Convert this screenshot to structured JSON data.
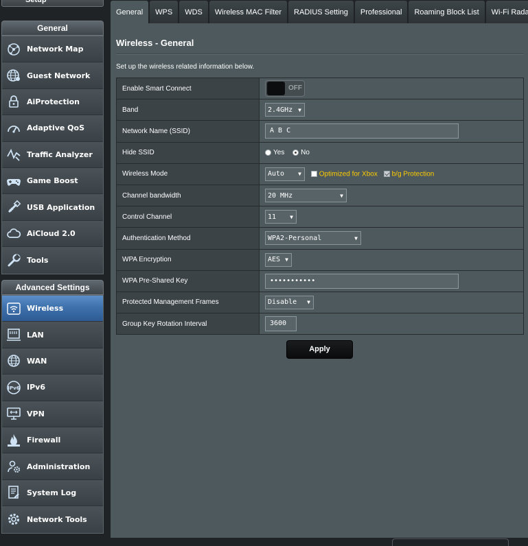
{
  "sidebar": {
    "setup_label": "Setup",
    "general_header": "General",
    "general_items": [
      {
        "label": "Network Map",
        "icon": "network-map-icon"
      },
      {
        "label": "Guest Network",
        "icon": "globe-icon"
      },
      {
        "label": "AiProtection",
        "icon": "lock-icon"
      },
      {
        "label": "Adaptive QoS",
        "icon": "gauge-icon"
      },
      {
        "label": "Traffic Analyzer",
        "icon": "traffic-icon"
      },
      {
        "label": "Game Boost",
        "icon": "gamepad-icon"
      },
      {
        "label": "USB Application",
        "icon": "usb-icon"
      },
      {
        "label": "AiCloud 2.0",
        "icon": "cloud-icon"
      },
      {
        "label": "Tools",
        "icon": "wrench-icon"
      }
    ],
    "advanced_header": "Advanced Settings",
    "advanced_items": [
      {
        "label": "Wireless",
        "icon": "wifi-icon",
        "active": true
      },
      {
        "label": "LAN",
        "icon": "lan-icon"
      },
      {
        "label": "WAN",
        "icon": "wan-globe-icon"
      },
      {
        "label": "IPv6",
        "icon": "ipv6-icon"
      },
      {
        "label": "VPN",
        "icon": "vpn-icon"
      },
      {
        "label": "Firewall",
        "icon": "fire-icon"
      },
      {
        "label": "Administration",
        "icon": "admin-gear-icon"
      },
      {
        "label": "System Log",
        "icon": "log-icon"
      },
      {
        "label": "Network Tools",
        "icon": "tools-gear-icon"
      }
    ]
  },
  "tabs": [
    "General",
    "WPS",
    "WDS",
    "Wireless MAC Filter",
    "RADIUS Setting",
    "Professional",
    "Roaming Block List",
    "Wi-Fi Radar"
  ],
  "active_tab": "General",
  "page": {
    "title": "Wireless - General",
    "description": "Set up the wireless related information below."
  },
  "settings": {
    "smart_connect": {
      "label": "Enable Smart Connect",
      "state": "OFF"
    },
    "band": {
      "label": "Band",
      "value": "2.4GHz"
    },
    "ssid": {
      "label": "Network Name (SSID)",
      "value": "A B C"
    },
    "hide_ssid": {
      "label": "Hide SSID",
      "yes": "Yes",
      "no": "No",
      "selected": "No"
    },
    "wireless_mode": {
      "label": "Wireless Mode",
      "value": "Auto",
      "xbox_label": "Optimized for Xbox",
      "bg_label": "b/g Protection",
      "xbox_checked": false,
      "bg_checked": true
    },
    "channel_bandwidth": {
      "label": "Channel bandwidth",
      "value": "20 MHz"
    },
    "control_channel": {
      "label": "Control Channel",
      "value": "11"
    },
    "auth_method": {
      "label": "Authentication Method",
      "value": "WPA2-Personal"
    },
    "wpa_encryption": {
      "label": "WPA Encryption",
      "value": "AES"
    },
    "wpa_psk": {
      "label": "WPA Pre-Shared Key",
      "value": "•••••••••••"
    },
    "pmf": {
      "label": "Protected Management Frames",
      "value": "Disable"
    },
    "gkri": {
      "label": "Group Key Rotation Interval",
      "value": "3600"
    }
  },
  "apply_label": "Apply",
  "colors": {
    "active_blue": "#3f72ad",
    "panel": "#4d595d",
    "highlight_yellow": "#ffcc00"
  }
}
